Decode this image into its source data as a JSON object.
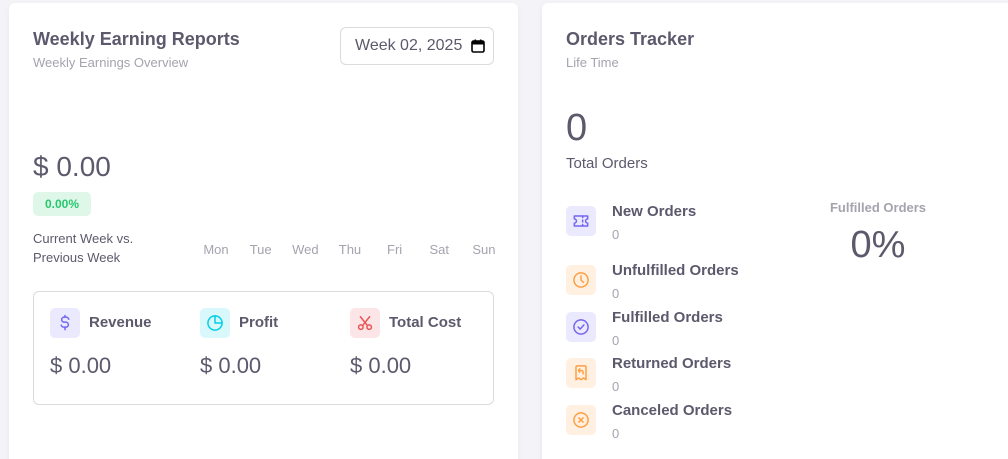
{
  "earnings": {
    "title": "Weekly Earning Reports",
    "subtitle": "Weekly Earnings Overview",
    "week_value": "Week 02, 2025",
    "amount": "$ 0.00",
    "badge": "0.00%",
    "compare_label": "Current Week vs. Previous Week",
    "days": [
      "Mon",
      "Tue",
      "Wed",
      "Thu",
      "Fri",
      "Sat",
      "Sun"
    ],
    "stats": [
      {
        "label": "Revenue",
        "value": "$ 0.00",
        "icon": "dollar-icon",
        "color": "#7367f0",
        "bg": "#ebe9fd"
      },
      {
        "label": "Profit",
        "value": "$ 0.00",
        "icon": "chart-pie-icon",
        "color": "#00cfe8",
        "bg": "#d9f8fc"
      },
      {
        "label": "Total Cost",
        "value": "$ 0.00",
        "icon": "scissors-icon",
        "color": "#ea5455",
        "bg": "#fce5e6"
      }
    ]
  },
  "orders": {
    "title": "Orders Tracker",
    "subtitle": "Life Time",
    "total": "0",
    "total_label": "Total Orders",
    "items": [
      {
        "name": "New Orders",
        "count": "0",
        "icon": "ticket-icon",
        "color": "#7367f0",
        "bg": "#ebe9fd"
      },
      {
        "name": "Unfulfilled Orders",
        "count": "0",
        "icon": "clock-icon",
        "color": "#ff9f43",
        "bg": "#fff0e1"
      },
      {
        "name": "Fulfilled Orders",
        "count": "0",
        "icon": "circle-check-icon",
        "color": "#7367f0",
        "bg": "#ebe9fd"
      },
      {
        "name": "Returned Orders",
        "count": "0",
        "icon": "receipt-refund-icon",
        "color": "#ff9f43",
        "bg": "#fff0e1"
      },
      {
        "name": "Canceled Orders",
        "count": "0",
        "icon": "circle-x-icon",
        "color": "#ff9f43",
        "bg": "#fff0e1"
      }
    ],
    "fulfilled_label": "Fulfilled Orders",
    "fulfilled_pct": "0%"
  }
}
